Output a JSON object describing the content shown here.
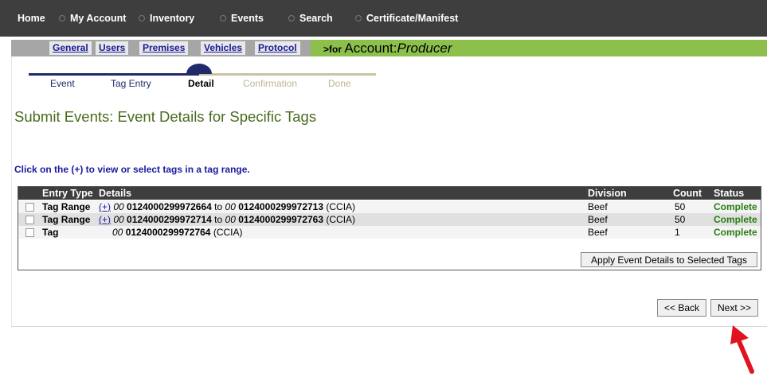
{
  "top_nav": {
    "items": [
      {
        "label": "Home"
      },
      {
        "label": "My Account"
      },
      {
        "label": "Inventory"
      },
      {
        "label": "Events"
      },
      {
        "label": "Search"
      },
      {
        "label": "Certificate/Manifest"
      }
    ]
  },
  "sub_nav": {
    "tabs": [
      {
        "label": "General"
      },
      {
        "label": "Users"
      },
      {
        "label": "Premises"
      },
      {
        "label": "Vehicles"
      },
      {
        "label": "Protocol"
      }
    ],
    "for_prefix": ">for",
    "account_prefix": "Account:",
    "account_type": "Producer"
  },
  "stepper": {
    "steps": [
      {
        "label": "Event",
        "state": "done"
      },
      {
        "label": "Tag Entry",
        "state": "done"
      },
      {
        "label": "Detail",
        "state": "current"
      },
      {
        "label": "Confirmation",
        "state": "pending"
      },
      {
        "label": "Done",
        "state": "pending"
      }
    ],
    "done_color": "#1f2a6b",
    "pending_color": "#c9c3a0"
  },
  "page_title": "Submit Events: Event Details for Specific Tags",
  "hint": "Click on the (+) to view or select tags in a tag range.",
  "table": {
    "headers": {
      "entry_type": "Entry Type",
      "details": "Details",
      "division": "Division",
      "count": "Count",
      "status": "Status"
    },
    "rows": [
      {
        "entry_type": "Tag Range",
        "plus": "(+)",
        "start_prefix": "00",
        "start_num": "0124000299972664",
        "to": "to",
        "end_prefix": "00",
        "end_num": "0124000299972713",
        "suffix": "(CCIA)",
        "division": "Beef",
        "count": "50",
        "status": "Complete"
      },
      {
        "entry_type": "Tag Range",
        "plus": "(+)",
        "start_prefix": "00",
        "start_num": "0124000299972714",
        "to": "to",
        "end_prefix": "00",
        "end_num": "0124000299972763",
        "suffix": "(CCIA)",
        "division": "Beef",
        "count": "50",
        "status": "Complete"
      },
      {
        "entry_type": "Tag",
        "start_prefix": "00",
        "start_num": "0124000299972764",
        "suffix": "(CCIA)",
        "division": "Beef",
        "count": "1",
        "status": "Complete"
      }
    ],
    "apply_button": "Apply Event Details to Selected Tags"
  },
  "buttons": {
    "back": "<< Back",
    "next": "Next >>"
  },
  "colors": {
    "nav_bg": "#3e3e3e",
    "green_bar": "#8dbf4d",
    "title_green": "#4a6b1e",
    "status_green": "#2a7d12",
    "link_blue": "#1a1aa0",
    "arrow_red": "#e0141e"
  },
  "icons": {
    "annotation": "red-arrow-icon"
  }
}
